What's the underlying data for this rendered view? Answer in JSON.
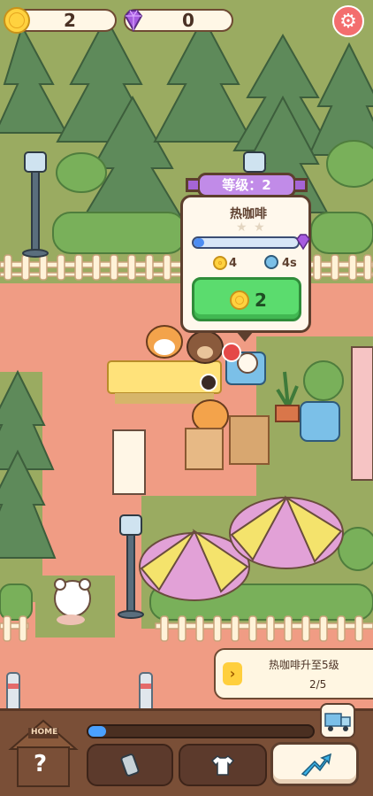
{
  "hud": {
    "coins": "2",
    "gems": "0"
  },
  "popup": {
    "level_label": "等级：2",
    "item_name": "热咖啡",
    "progress_fraction": 0.1,
    "coin_reward": "4",
    "time": "4s",
    "upgrade_cost": "2",
    "stars": 2
  },
  "quest": {
    "text": "热咖啡升至5级",
    "count": "2/5"
  },
  "bottom": {
    "xp_fraction": 0.08,
    "home_sign": "HOME",
    "home_mark": "?"
  },
  "icons": [
    "gear-icon",
    "coin-icon",
    "gem-icon",
    "upgrade-icon",
    "truck-icon",
    "tshirt-icon",
    "phone-icon",
    "arrow-up-icon",
    "chevron-right-icon",
    "clock-icon"
  ],
  "colors": {
    "path": "#f09c84",
    "grass": "#8da15c",
    "accent": "#c18be8",
    "buy": "#5bdc6e"
  }
}
